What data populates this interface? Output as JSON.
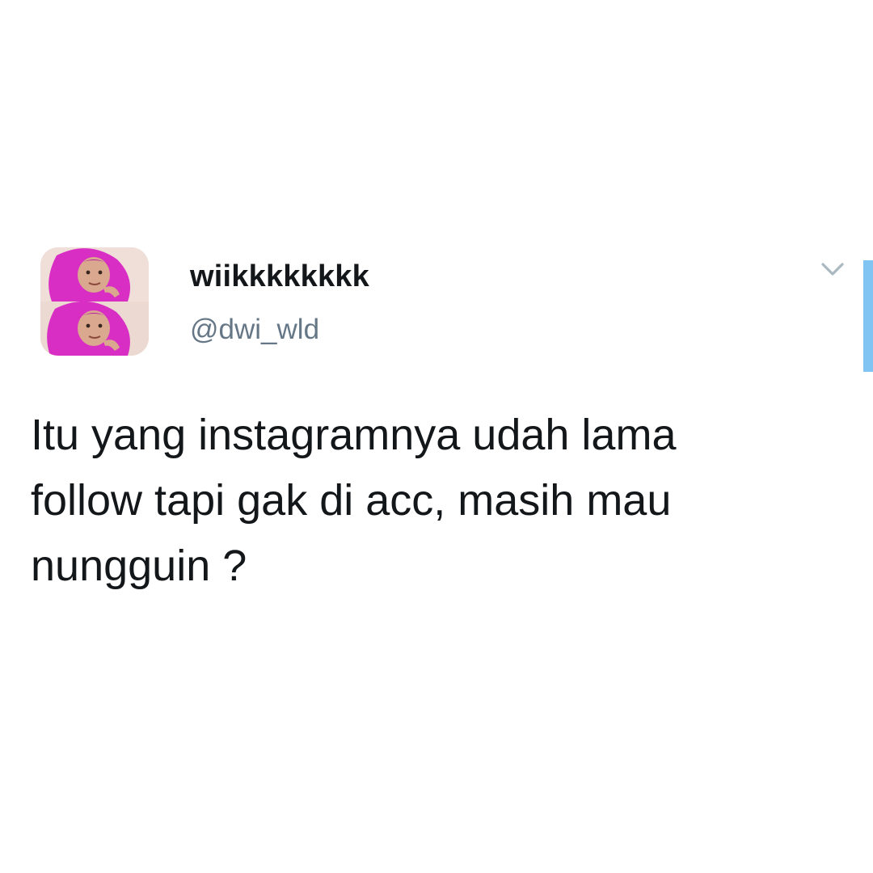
{
  "tweet": {
    "display_name": "wiikkkkkkkk",
    "handle": "@dwi_wld",
    "text": "Itu yang instagramnya udah lama\nfollow tapi gak di acc, masih mau\nnungguin ?"
  },
  "icons": {
    "more_menu": "chevron-down-icon",
    "avatar": "profile-photo"
  },
  "colors": {
    "text_primary": "#14171a",
    "text_secondary": "#657786",
    "accent_bar": "#7fc4f2",
    "hijab": "#d92ec4"
  }
}
